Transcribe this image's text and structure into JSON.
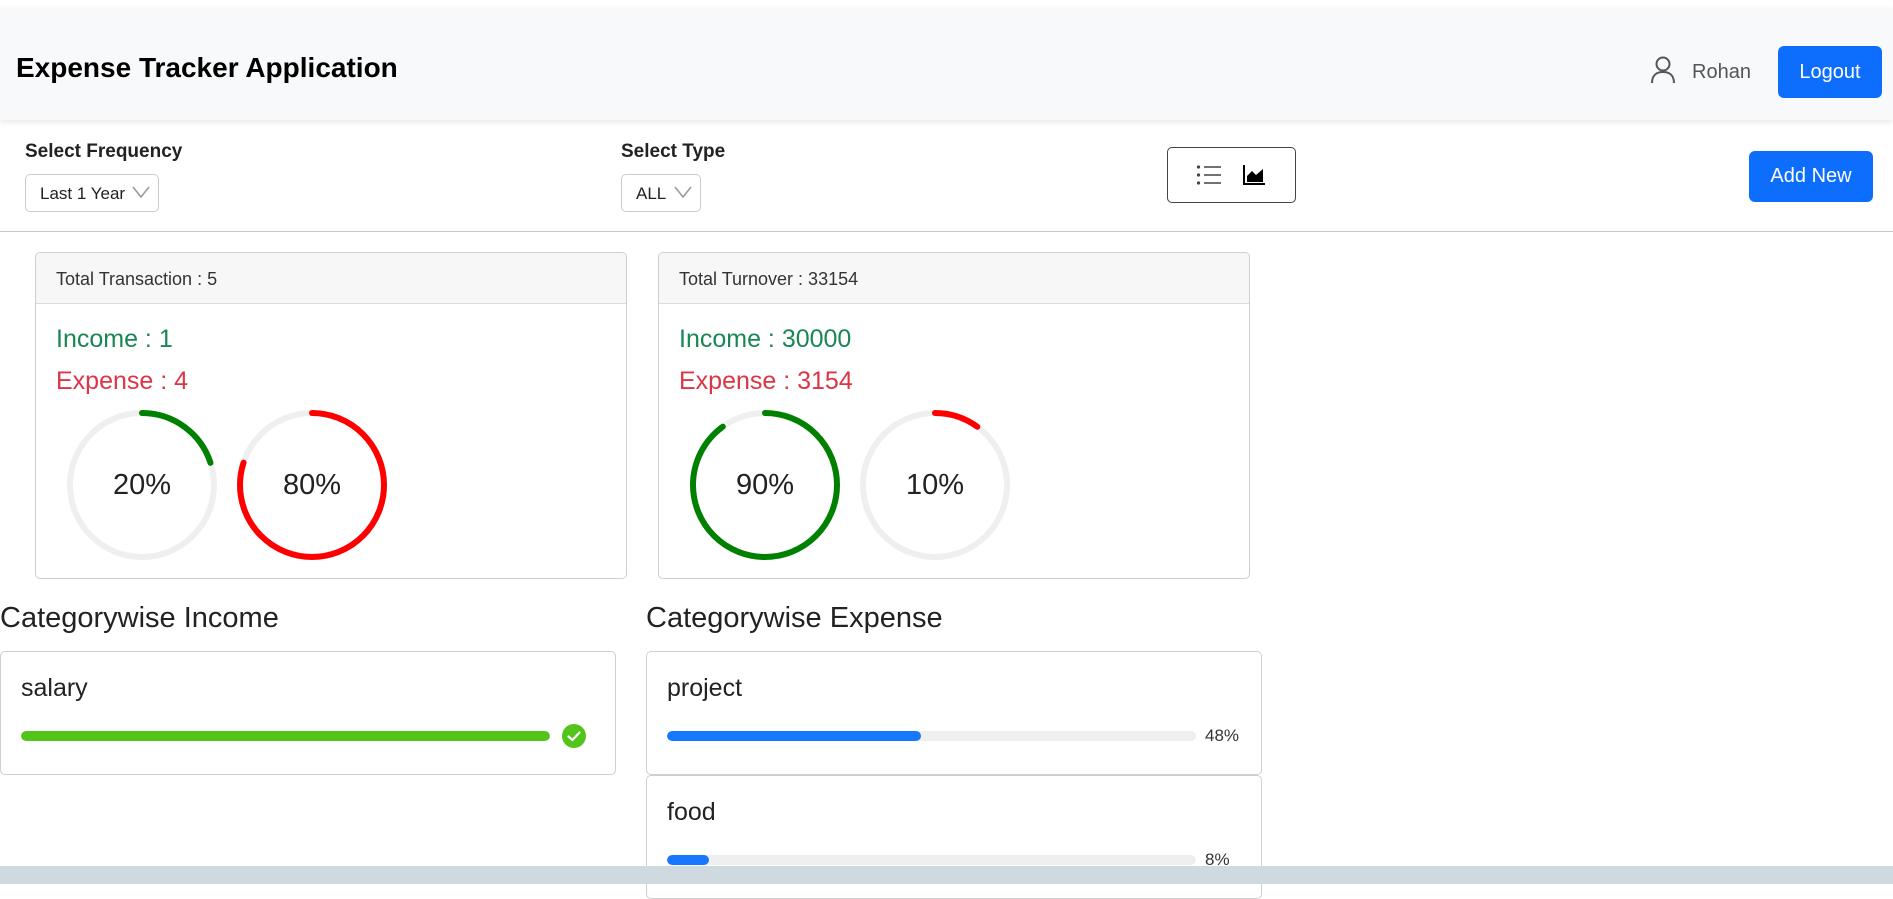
{
  "app": {
    "title": "Expense Tracker Application",
    "user_name": "Rohan",
    "logout_label": "Logout"
  },
  "filters": {
    "frequency_label": "Select Frequency",
    "frequency_value": "Last 1 Year",
    "type_label": "Select Type",
    "type_value": "ALL",
    "view_icons": [
      "list-icon",
      "area-chart-icon"
    ],
    "add_new_label": "Add New"
  },
  "colors": {
    "primary": "#0d6efd",
    "income": "#198754",
    "expense": "#dc3545",
    "income_gauge": "#008000",
    "expense_gauge": "#ff0000",
    "income_bar": "#52c41a",
    "expense_bar": "#1677ff"
  },
  "transactions_card": {
    "header": "Total Transaction : 5",
    "income_text": "Income : 1",
    "expense_text": "Expense : 4",
    "income_percent": 20,
    "income_percent_label": "20%",
    "expense_percent": 80,
    "expense_percent_label": "80%"
  },
  "turnover_card": {
    "header": "Total Turnover : 33154",
    "income_text": "Income : 30000",
    "expense_text": "Expense : 3154",
    "income_percent": 90,
    "income_percent_label": "90%",
    "expense_percent": 10,
    "expense_percent_label": "10%"
  },
  "categorywise_income": {
    "title": "Categorywise Income",
    "items": [
      {
        "name": "salary",
        "percent": 100,
        "complete": true
      }
    ]
  },
  "categorywise_expense": {
    "title": "Categorywise Expense",
    "items": [
      {
        "name": "project",
        "percent": 48,
        "percent_label": "48%"
      },
      {
        "name": "food",
        "percent": 8,
        "percent_label": "8%"
      }
    ]
  }
}
